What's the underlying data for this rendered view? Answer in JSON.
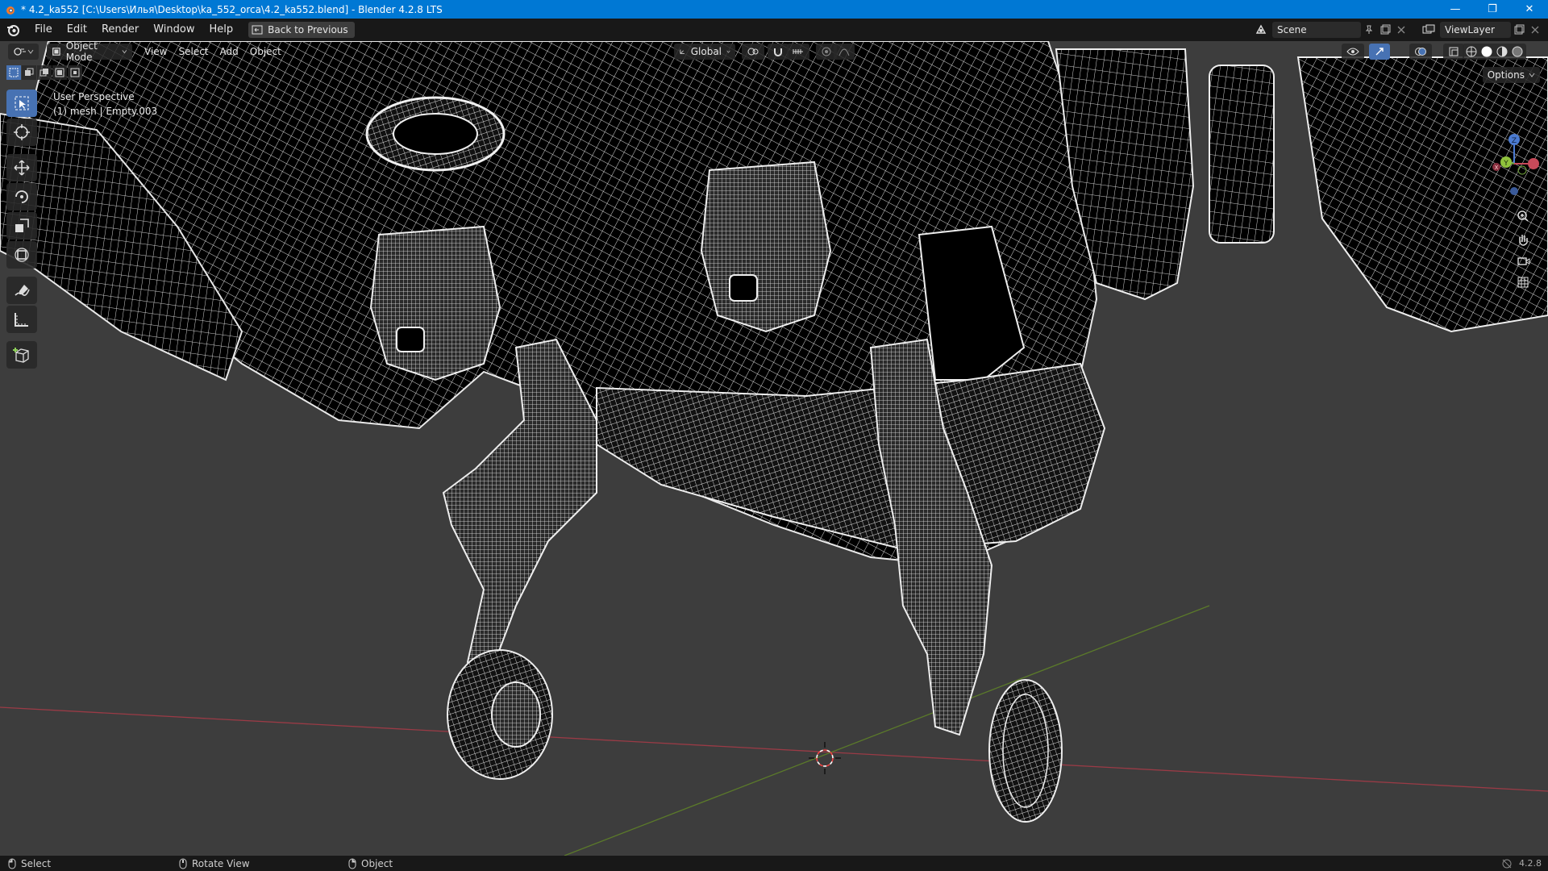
{
  "window": {
    "title": "* 4.2_ka552 [C:\\Users\\Илья\\Desktop\\ka_552_orca\\4.2_ka552.blend] - Blender 4.2.8 LTS",
    "minimize": "—",
    "maximize": "❐",
    "close": "✕"
  },
  "topbar": {
    "menus": [
      "File",
      "Edit",
      "Render",
      "Window",
      "Help"
    ],
    "back_label": "Back to Previous",
    "scene_label": "Scene",
    "viewlayer_label": "ViewLayer"
  },
  "viewport_header": {
    "mode_label": "Object Mode",
    "menus": [
      "View",
      "Select",
      "Add",
      "Object"
    ],
    "orientation_label": "Global",
    "options_label": "Options"
  },
  "viewport": {
    "perspective_label": "User Perspective",
    "object_info": "(1) mesh | Empty.003",
    "colors": {
      "background": "#3d3d3d",
      "wire": "#e8e8e8",
      "mesh_fill": "#000000",
      "x_axis": "#9a3b46",
      "y_axis": "#5b7a2a",
      "active_tool": "#4772b3"
    }
  },
  "toolbar": {
    "tools": [
      "select-box-icon",
      "cursor-icon",
      "move-icon",
      "rotate-icon",
      "scale-icon",
      "transform-icon",
      "annotate-icon",
      "measure-icon",
      "add-cube-icon"
    ]
  },
  "gizmo": {
    "x": "X",
    "y": "Y",
    "z": "Z"
  },
  "statusbar": {
    "select": "Select",
    "rotate": "Rotate View",
    "object": "Object",
    "version": "4.2.8"
  }
}
